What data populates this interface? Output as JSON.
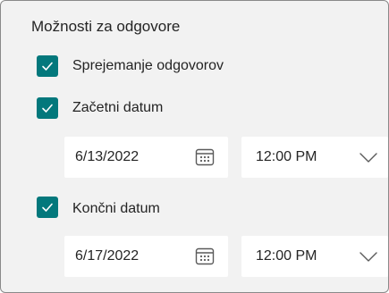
{
  "section": {
    "title": "Možnosti za odgovore"
  },
  "accept_responses": {
    "label": "Sprejemanje odgovorov",
    "checked": true
  },
  "start": {
    "label": "Začetni datum",
    "checked": true,
    "date": "6/13/2022",
    "time": "12:00 PM"
  },
  "end": {
    "label": "Končni datum",
    "checked": true,
    "date": "6/17/2022",
    "time": "12:00 PM"
  },
  "colors": {
    "accent": "#03787c",
    "panel": "#f2f2f2",
    "text": "#242424"
  },
  "icons": {
    "checkbox": "checkmark-icon",
    "date": "calendar-icon",
    "time": "chevron-down-icon"
  }
}
